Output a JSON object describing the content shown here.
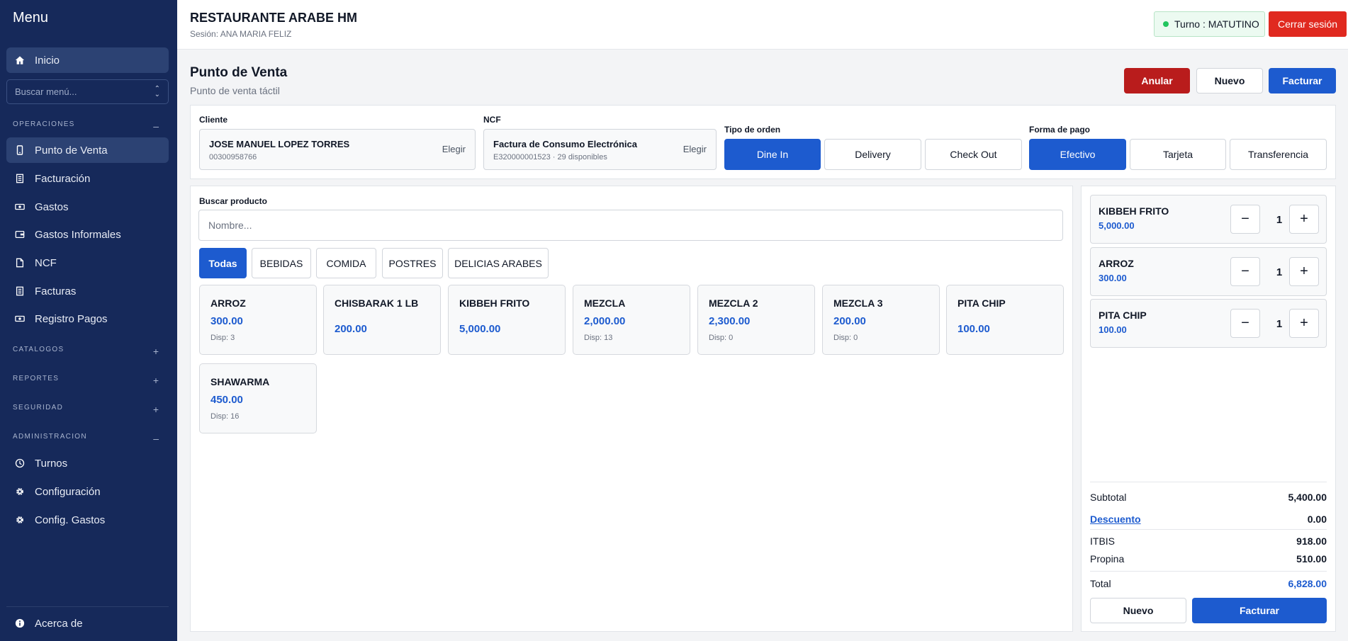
{
  "sidebar": {
    "title": "Menu",
    "home": "Inicio",
    "search_placeholder": "Buscar menú...",
    "sections": {
      "operaciones": "OPERACIONES",
      "catalogos": "CATALOGOS",
      "reportes": "REPORTES",
      "seguridad": "SEGURIDAD",
      "administracion": "ADMINISTRACION"
    },
    "operaciones_items": [
      "Punto de Venta",
      "Facturación",
      "Gastos",
      "Gastos Informales",
      "NCF",
      "Facturas",
      "Registro Pagos"
    ],
    "admin_items": [
      "Turnos",
      "Configuración",
      "Config. Gastos"
    ],
    "about": "Acerca de"
  },
  "header": {
    "title": "RESTAURANTE ARABE HM",
    "session": "Sesión: ANA MARIA FELIZ",
    "turno": "Turno : MATUTINO",
    "logout": "Cerrar sesión"
  },
  "page": {
    "title": "Punto de Venta",
    "subtitle": "Punto de venta táctil",
    "anular": "Anular",
    "nuevo": "Nuevo",
    "facturar": "Facturar"
  },
  "order": {
    "cliente_label": "Cliente",
    "cliente_name": "JOSE MANUEL LOPEZ TORRES",
    "cliente_id": "00300958766",
    "ncf_label": "NCF",
    "ncf_type": "Factura de Consumo Electrónica",
    "ncf_detail": "E320000001523 · 29 disponibles",
    "choose": "Elegir",
    "tipo_label": "Tipo de orden",
    "tipos": [
      "Dine In",
      "Delivery",
      "Check Out"
    ],
    "tipo_selected": "Dine In",
    "pago_label": "Forma de pago",
    "pagos": [
      "Efectivo",
      "Tarjeta",
      "Transferencia"
    ],
    "pago_selected": "Efectivo"
  },
  "products": {
    "search_label": "Buscar producto",
    "search_placeholder": "Nombre...",
    "categories": [
      "Todas",
      "BEBIDAS",
      "COMIDA",
      "POSTRES",
      "DELICIAS ARABES"
    ],
    "category_selected": "Todas",
    "items": [
      {
        "name": "ARROZ",
        "price": "300.00",
        "disp": "Disp: 3"
      },
      {
        "name": "CHISBARAK 1 LB",
        "price": "200.00",
        "disp": ""
      },
      {
        "name": "KIBBEH FRITO",
        "price": "5,000.00",
        "disp": ""
      },
      {
        "name": "MEZCLA",
        "price": "2,000.00",
        "disp": "Disp: 13"
      },
      {
        "name": "MEZCLA 2",
        "price": "2,300.00",
        "disp": "Disp: 0"
      },
      {
        "name": "MEZCLA 3",
        "price": "200.00",
        "disp": "Disp: 0"
      },
      {
        "name": "PITA CHIP",
        "price": "100.00",
        "disp": ""
      },
      {
        "name": "SHAWARMA",
        "price": "450.00",
        "disp": "Disp: 16"
      }
    ]
  },
  "cart": {
    "items": [
      {
        "name": "KIBBEH FRITO",
        "price": "5,000.00",
        "qty": "1"
      },
      {
        "name": "ARROZ",
        "price": "300.00",
        "qty": "1"
      },
      {
        "name": "PITA CHIP",
        "price": "100.00",
        "qty": "1"
      }
    ],
    "minus": "−",
    "plus": "+",
    "subtotal_label": "Subtotal",
    "subtotal": "5,400.00",
    "descuento_label": "Descuento",
    "descuento": "0.00",
    "itbis_label": "ITBIS",
    "itbis": "918.00",
    "propina_label": "Propina",
    "propina": "510.00",
    "total_label": "Total",
    "total": "6,828.00",
    "nuevo": "Nuevo",
    "facturar": "Facturar"
  },
  "colors": {
    "sidebar_bg": "#16295a",
    "primary": "#1d5bcf",
    "danger": "#b91c1c",
    "logout": "#e0291f",
    "status_dot": "#22c55e"
  }
}
